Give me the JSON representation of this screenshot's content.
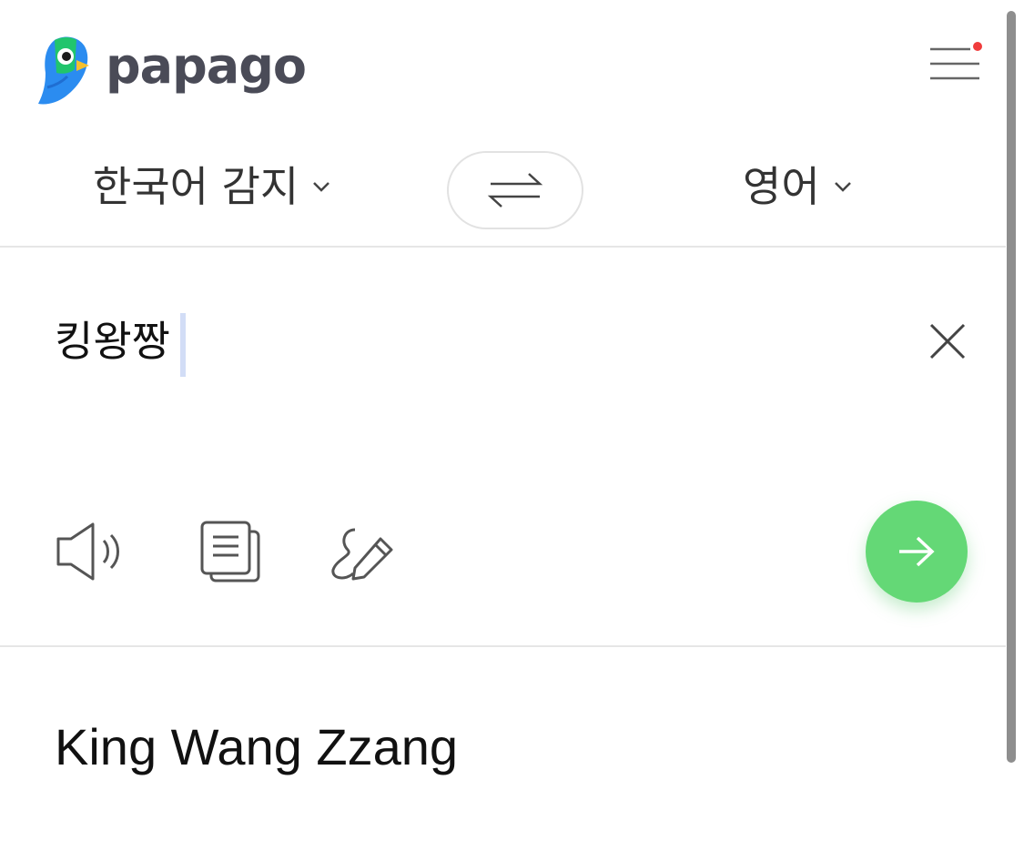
{
  "app": {
    "brand": "papago"
  },
  "header": {
    "menu_has_notification": true,
    "notification_color": "#f03c3c"
  },
  "languages": {
    "source_label": "한국어 감지",
    "target_label": "영어"
  },
  "source": {
    "text": "킹왕짱"
  },
  "toolbar": {
    "icons": [
      "speaker-icon",
      "copy-icon",
      "handwriting-icon"
    ],
    "translate_button_color": "#64d876"
  },
  "result": {
    "text": "King Wang Zzang"
  },
  "colors": {
    "brand_text": "#4a4b57",
    "accent_green": "#64d876",
    "bird_blue": "#2b8cf0"
  }
}
